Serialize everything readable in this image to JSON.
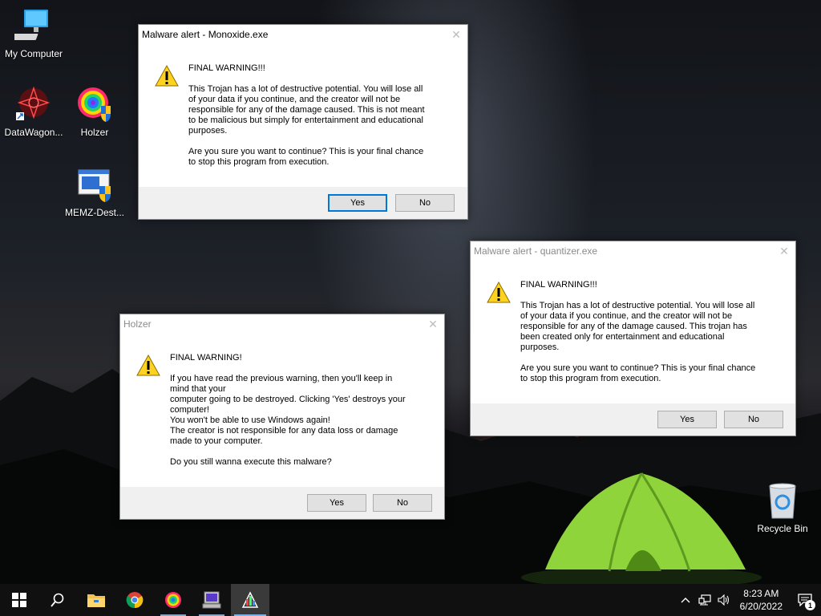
{
  "desktop": {
    "icons": [
      {
        "label": "My Computer"
      },
      {
        "label": "DataWagon..."
      },
      {
        "label": "Holzer"
      },
      {
        "label": "MEMZ-Dest..."
      },
      {
        "label": "Recycle Bin"
      }
    ]
  },
  "dialogs": {
    "monoxide": {
      "title": "Malware alert - Monoxide.exe",
      "message": "FINAL WARNING!!!\n\nThis Trojan has a lot of destructive potential. You will lose all\nof your data if you continue, and the creator will not be\nresponsible for any of the damage caused. This is not meant\nto be malicious but simply for entertainment and educational\npurposes.\n\nAre you sure you want to continue? This is your final chance\nto stop this program from execution.",
      "yes": "Yes",
      "no": "No",
      "close": "✕"
    },
    "quantizer": {
      "title": "Malware alert - quantizer.exe",
      "message": "FINAL WARNING!!!\n\nThis Trojan has a lot of destructive potential. You will lose all\nof your data if you continue, and the creator will not be\nresponsible for any of the damage caused. This trojan has\nbeen created only for entertainment and educational\npurposes.\n\nAre you sure you want to continue? This is your final chance\nto stop this program from execution.",
      "yes": "Yes",
      "no": "No",
      "close": "✕"
    },
    "holzer": {
      "title": "Holzer",
      "message": "FINAL WARNING!\n\nIf you have read the previous warning, then you'll keep in\nmind that your\ncomputer going to be destroyed. Clicking 'Yes' destroys your\ncomputer!\nYou won't be able to use Windows again!\nThe creator is not responsible for any data loss or damage\nmade to your computer.\n\nDo you still wanna execute this malware?",
      "yes": "Yes",
      "no": "No",
      "close": "✕"
    }
  },
  "taskbar": {
    "items": [
      "start-icon",
      "search-icon",
      "file-explorer-icon",
      "chrome-icon",
      "holzer-icon",
      "computer-app-icon",
      "monoxide-icon"
    ],
    "clock": {
      "time": "8:23 AM",
      "date": "6/20/2022"
    },
    "notification_count": "1"
  },
  "colors": {
    "accent": "#0078d7",
    "taskbar": "#101010",
    "tent": "#8fd43a"
  }
}
